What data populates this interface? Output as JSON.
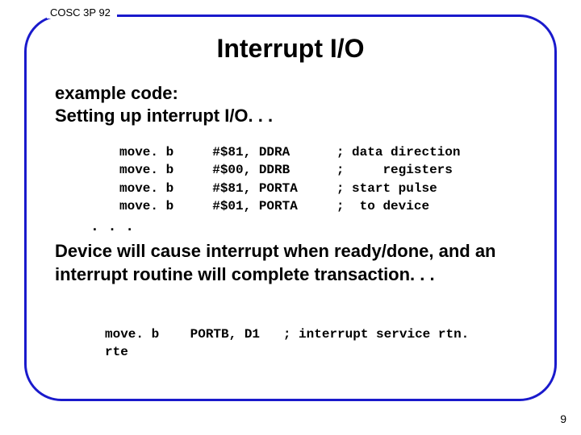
{
  "course_tag": "COSC 3P 92",
  "title": "Interrupt I/O",
  "subtitle_line1": "example code:",
  "subtitle_line2": "Setting up interrupt I/O. . .",
  "code1": {
    "l1": "move. b     #$81, DDRA      ; data direction",
    "l2": "move. b     #$00, DDRB      ;     registers",
    "l3": "move. b     #$81, PORTA     ; start pulse",
    "l4": "move. b     #$01, PORTA     ;  to device"
  },
  "ellipsis": ". . .",
  "paragraph": "Device will cause interrupt when ready/done, and an interrupt routine will complete transaction. . .",
  "code2": {
    "l1": "move. b    PORTB, D1   ; interrupt service rtn.",
    "l2": "rte"
  },
  "page_number": "9"
}
